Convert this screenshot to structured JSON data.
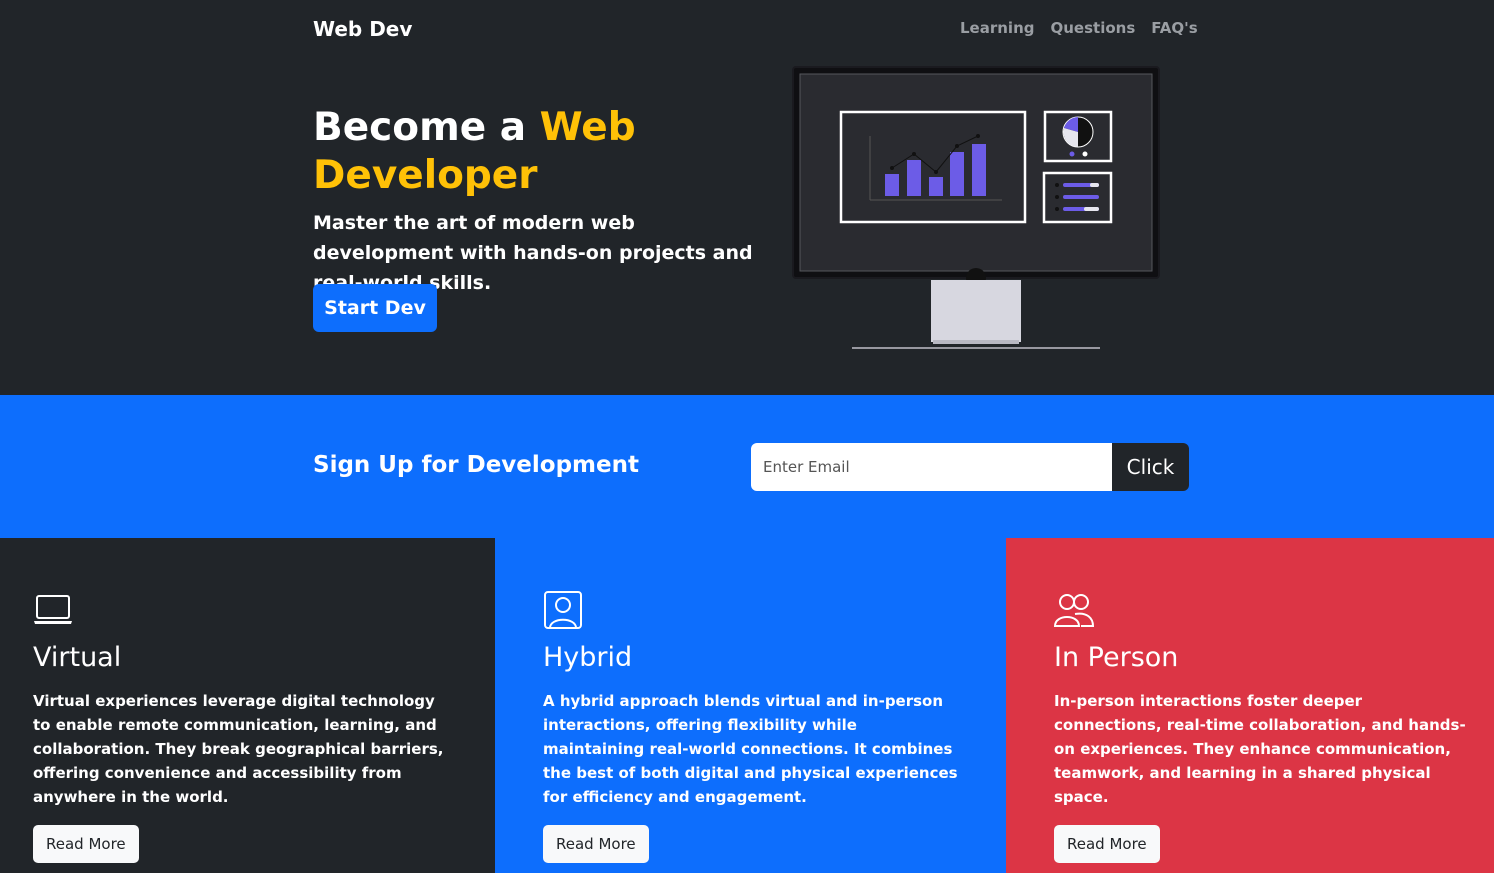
{
  "nav": {
    "brand": "Web Dev",
    "links": [
      "Learning",
      "Questions",
      "FAQ's"
    ]
  },
  "hero": {
    "title_part1": "Become a ",
    "title_accent": "Web Developer",
    "subtitle": "Master the art of modern web development with hands-on projects and real-world skills.",
    "button_label": "Start Dev",
    "illustration": "monitor-dashboard-illustration"
  },
  "signup": {
    "title": "Sign Up for Development",
    "email_placeholder": "Enter Email",
    "button_label": "Click"
  },
  "cards": [
    {
      "icon": "laptop-icon",
      "title": "Virtual",
      "text": "Virtual experiences leverage digital technology to enable remote communication, learning, and collaboration. They break geographical barriers, offering convenience and accessibility from anywhere in the world.",
      "button_label": "Read More"
    },
    {
      "icon": "person-badge-icon",
      "title": "Hybrid",
      "text": "A hybrid approach blends virtual and in-person interactions, offering flexibility while maintaining real-world connections. It combines the best of both digital and physical experiences for efficiency and engagement.",
      "button_label": "Read More"
    },
    {
      "icon": "people-icon",
      "title": "In Person",
      "text": "In-person interactions foster deeper connections, real-time collaboration, and hands-on experiences. They enhance communication, teamwork, and learning in a shared physical space.",
      "button_label": "Read More"
    }
  ],
  "colors": {
    "dark": "#212529",
    "primary": "#0d6efd",
    "danger": "#dc3545",
    "accent": "#ffc107",
    "nav_link": "#9a9ea3",
    "chart_bar": "#6c5ce7"
  }
}
